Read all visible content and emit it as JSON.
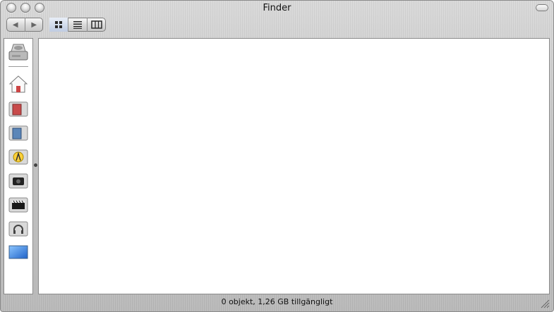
{
  "window": {
    "title": "Finder"
  },
  "toolbar": {
    "back_icon": "triangle-left-icon",
    "forward_icon": "triangle-right-icon",
    "view_modes": [
      {
        "name": "icon-view-icon",
        "selected": true
      },
      {
        "name": "list-view-icon",
        "selected": false
      },
      {
        "name": "column-view-icon",
        "selected": false
      }
    ]
  },
  "sidebar": {
    "items": [
      {
        "name": "hard-drive-icon"
      },
      {
        "name": "home-icon"
      },
      {
        "name": "red-folder-icon"
      },
      {
        "name": "blue-folder-icon"
      },
      {
        "name": "applications-folder-icon"
      },
      {
        "name": "camera-folder-icon"
      },
      {
        "name": "movies-folder-icon"
      },
      {
        "name": "music-folder-icon"
      },
      {
        "name": "desktop-icon"
      }
    ]
  },
  "status": {
    "text": "0 objekt, 1,26 GB tillgängligt"
  }
}
